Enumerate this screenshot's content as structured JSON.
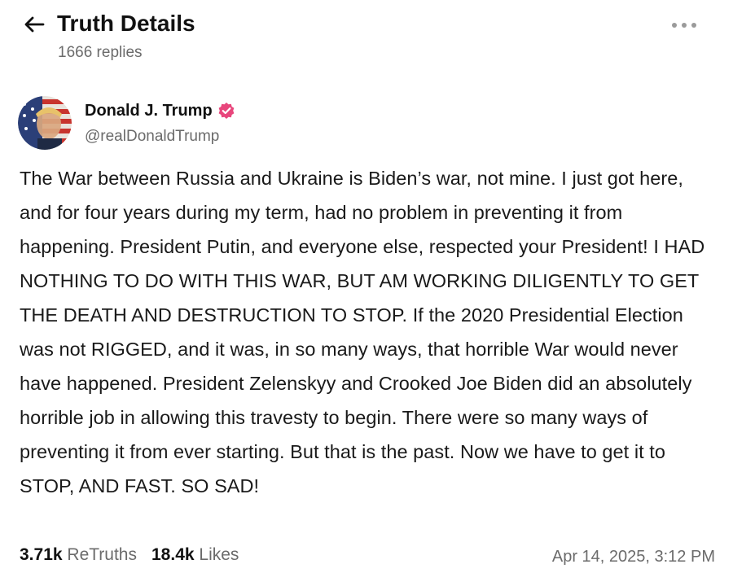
{
  "header": {
    "title": "Truth Details",
    "replies": "1666 replies",
    "icons": {
      "back": "arrow-left-icon",
      "more": "ellipsis-icon"
    }
  },
  "post": {
    "author": {
      "name": "Donald J. Trump",
      "handle": "@realDonaldTrump",
      "verified": true,
      "verified_color": "#e8467c"
    },
    "body": "The War between Russia and Ukraine is Biden’s war, not mine. I just got here, and for four years during my term, had no problem in preventing it from happening. President Putin, and everyone else, respected your President! I HAD NOTHING TO DO WITH THIS WAR, BUT AM WORKING DILIGENTLY TO GET THE DEATH AND DESTRUCTION TO STOP. If the 2020 Presidential Election was not RIGGED, and it was, in so many ways, that horrible War would never have happened. President Zelenskyy and Crooked Joe Biden did an absolutely horrible job in allowing this travesty to begin. There were so many ways of preventing it from ever starting. But that is the past. Now we have to get it to STOP, AND FAST. SO SAD!",
    "stats": {
      "retruths_count": "3.71k",
      "retruths_label": "ReTruths",
      "likes_count": "18.4k",
      "likes_label": "Likes"
    },
    "timestamp": "Apr 14, 2025, 3:12 PM"
  }
}
